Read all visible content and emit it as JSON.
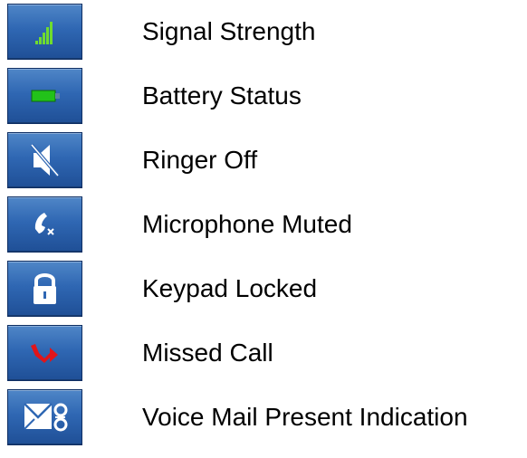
{
  "legend": {
    "items": [
      {
        "icon": "signal-strength-icon",
        "label": "Signal Strength"
      },
      {
        "icon": "battery-icon",
        "label": "Battery Status"
      },
      {
        "icon": "ringer-off-icon",
        "label": "Ringer Off"
      },
      {
        "icon": "microphone-muted-icon",
        "label": "Microphone Muted"
      },
      {
        "icon": "padlock-icon",
        "label": "Keypad Locked"
      },
      {
        "icon": "missed-call-icon",
        "label": "Missed Call"
      },
      {
        "icon": "voice-mail-icon",
        "label": "Voice Mail Present Indication"
      }
    ]
  },
  "colors": {
    "tile_blue": "#2f67b3",
    "tile_border": "#0e2e63",
    "signal_green": "#6fdc2e",
    "battery_green": "#22c21a",
    "missed_call_red": "#e0151a",
    "icon_white": "#ffffff"
  }
}
